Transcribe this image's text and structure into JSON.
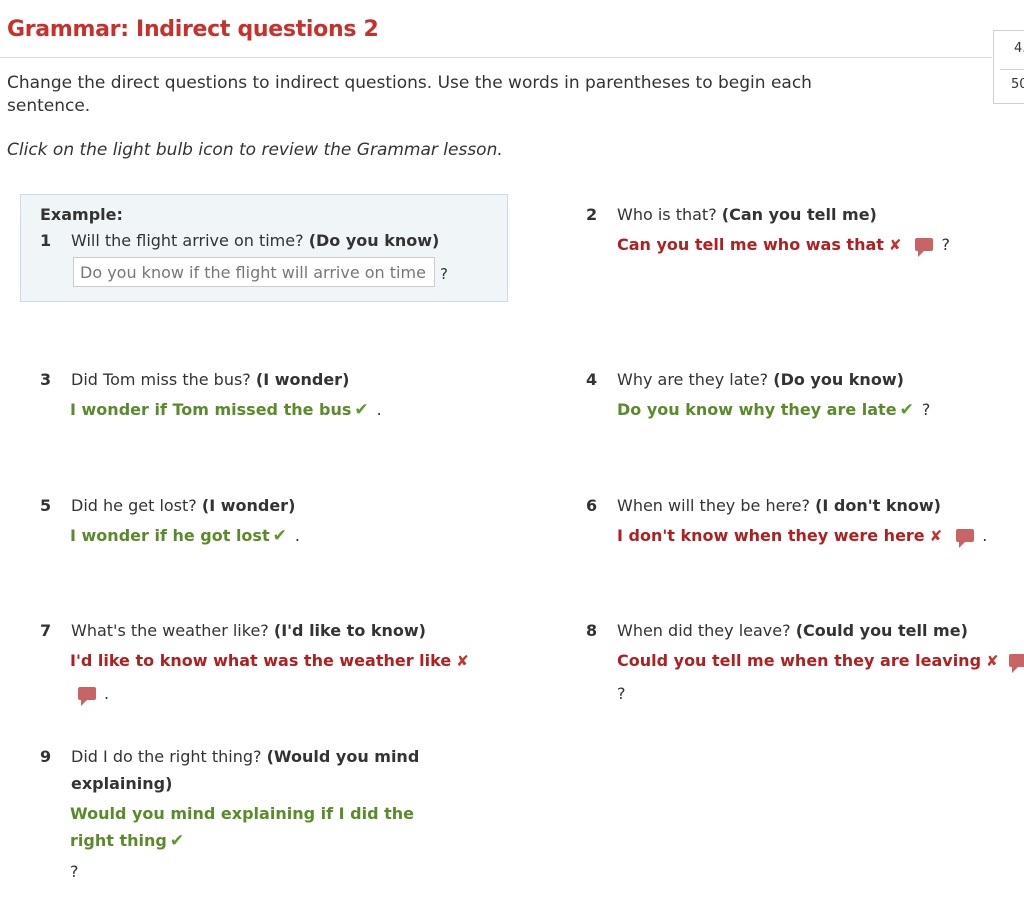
{
  "header": {
    "title": "Grammar: Indirect questions 2"
  },
  "score": {
    "line1": "4.",
    "line2": "50"
  },
  "instructions": "Change the direct questions to indirect questions. Use the words in parentheses to begin each sentence.",
  "hint": "Click on the light bulb icon to review the Grammar lesson.",
  "example": {
    "label": "Example:",
    "number": "1",
    "question": "Will the flight arrive on time?",
    "cue": "(Do you know)",
    "answer_value": "Do you know if the flight will arrive on time",
    "end_punct": "?"
  },
  "questions": [
    {
      "number": "2",
      "question": "Who is that?",
      "cue": "(Can you tell me)",
      "answer": "Can you tell me who was that",
      "status": "wrong",
      "end_punct": "?"
    },
    {
      "number": "3",
      "question": "Did Tom miss the bus?",
      "cue": "(I wonder)",
      "answer": "I wonder if Tom missed the bus",
      "status": "correct",
      "end_punct": "."
    },
    {
      "number": "4",
      "question": "Why are they late?",
      "cue": "(Do you know)",
      "answer": "Do you know why they are late",
      "status": "correct",
      "end_punct": "?"
    },
    {
      "number": "5",
      "question": "Did he get lost?",
      "cue": "(I wonder)",
      "answer": "I wonder if he got lost",
      "status": "correct",
      "end_punct": "."
    },
    {
      "number": "6",
      "question": "When will they be here?",
      "cue": "(I don't know)",
      "answer": "I don't know when they were here",
      "status": "wrong",
      "end_punct": "."
    },
    {
      "number": "7",
      "question": "What's the weather like?",
      "cue": "(I'd like to know)",
      "answer": "I'd like to know what was the weather like",
      "status": "wrong",
      "end_punct": "."
    },
    {
      "number": "8",
      "question": "When did they leave?",
      "cue": "(Could you tell me)",
      "answer": "Could you tell me when they are leaving",
      "status": "wrong",
      "end_punct": "?"
    },
    {
      "number": "9",
      "question": "Did I do the right thing?",
      "cue": "(Would you mind explaining)",
      "answer": "Would you mind explaining if I did the right thing",
      "status": "correct",
      "end_punct": "?"
    }
  ],
  "marks": {
    "correct": "✔",
    "wrong": "✘"
  },
  "colors": {
    "title": "#c9302c",
    "correct": "#5a8a2a",
    "wrong": "#b02020",
    "feedback_bubble": "#c86464"
  },
  "icons": {
    "correct": "checkmark-icon",
    "wrong": "cross-icon",
    "feedback": "speech-bubble-icon"
  }
}
